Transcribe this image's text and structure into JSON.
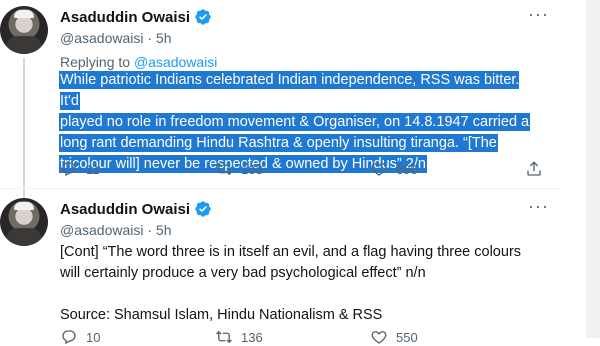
{
  "tweet1": {
    "name": "Asaduddin Owaisi",
    "handle": "@asadowaisi · 5h",
    "replying_prefix": "Replying to ",
    "replying_handle": "@asadowaisi",
    "text_lines": [
      "While patriotic Indians celebrated Indian independence, RSS was bitter. It'd",
      "played no role in freedom movement & Organiser, on 14.8.1947 carried a",
      "long rant demanding Hindu Rashtra & openly insulting tiranga. “[The",
      "tricolour will] never be respected & owned by Hindus” 2/n"
    ],
    "replies": "11",
    "retweets": "163",
    "likes": "690"
  },
  "tweet2": {
    "name": "Asaduddin Owaisi",
    "handle": "@asadowaisi · 5h",
    "text_lines": [
      "[Cont] “The word three is in itself an evil, and a flag having three colours",
      "will certainly produce a very bad psychological effect” n/n",
      "",
      "Source: Shamsul Islam, Hindu Nationalism & RSS"
    ],
    "replies": "10",
    "retweets": "136",
    "likes": "550"
  },
  "icons": {
    "more": "more-icon",
    "verified": "verified-badge-icon",
    "reply": "reply-icon",
    "retweet": "retweet-icon",
    "like": "heart-icon",
    "share": "share-icon"
  },
  "colors": {
    "accent": "#1d9bf0",
    "selection": "#1f79d2",
    "muted": "#536471"
  },
  "more_label": "···"
}
